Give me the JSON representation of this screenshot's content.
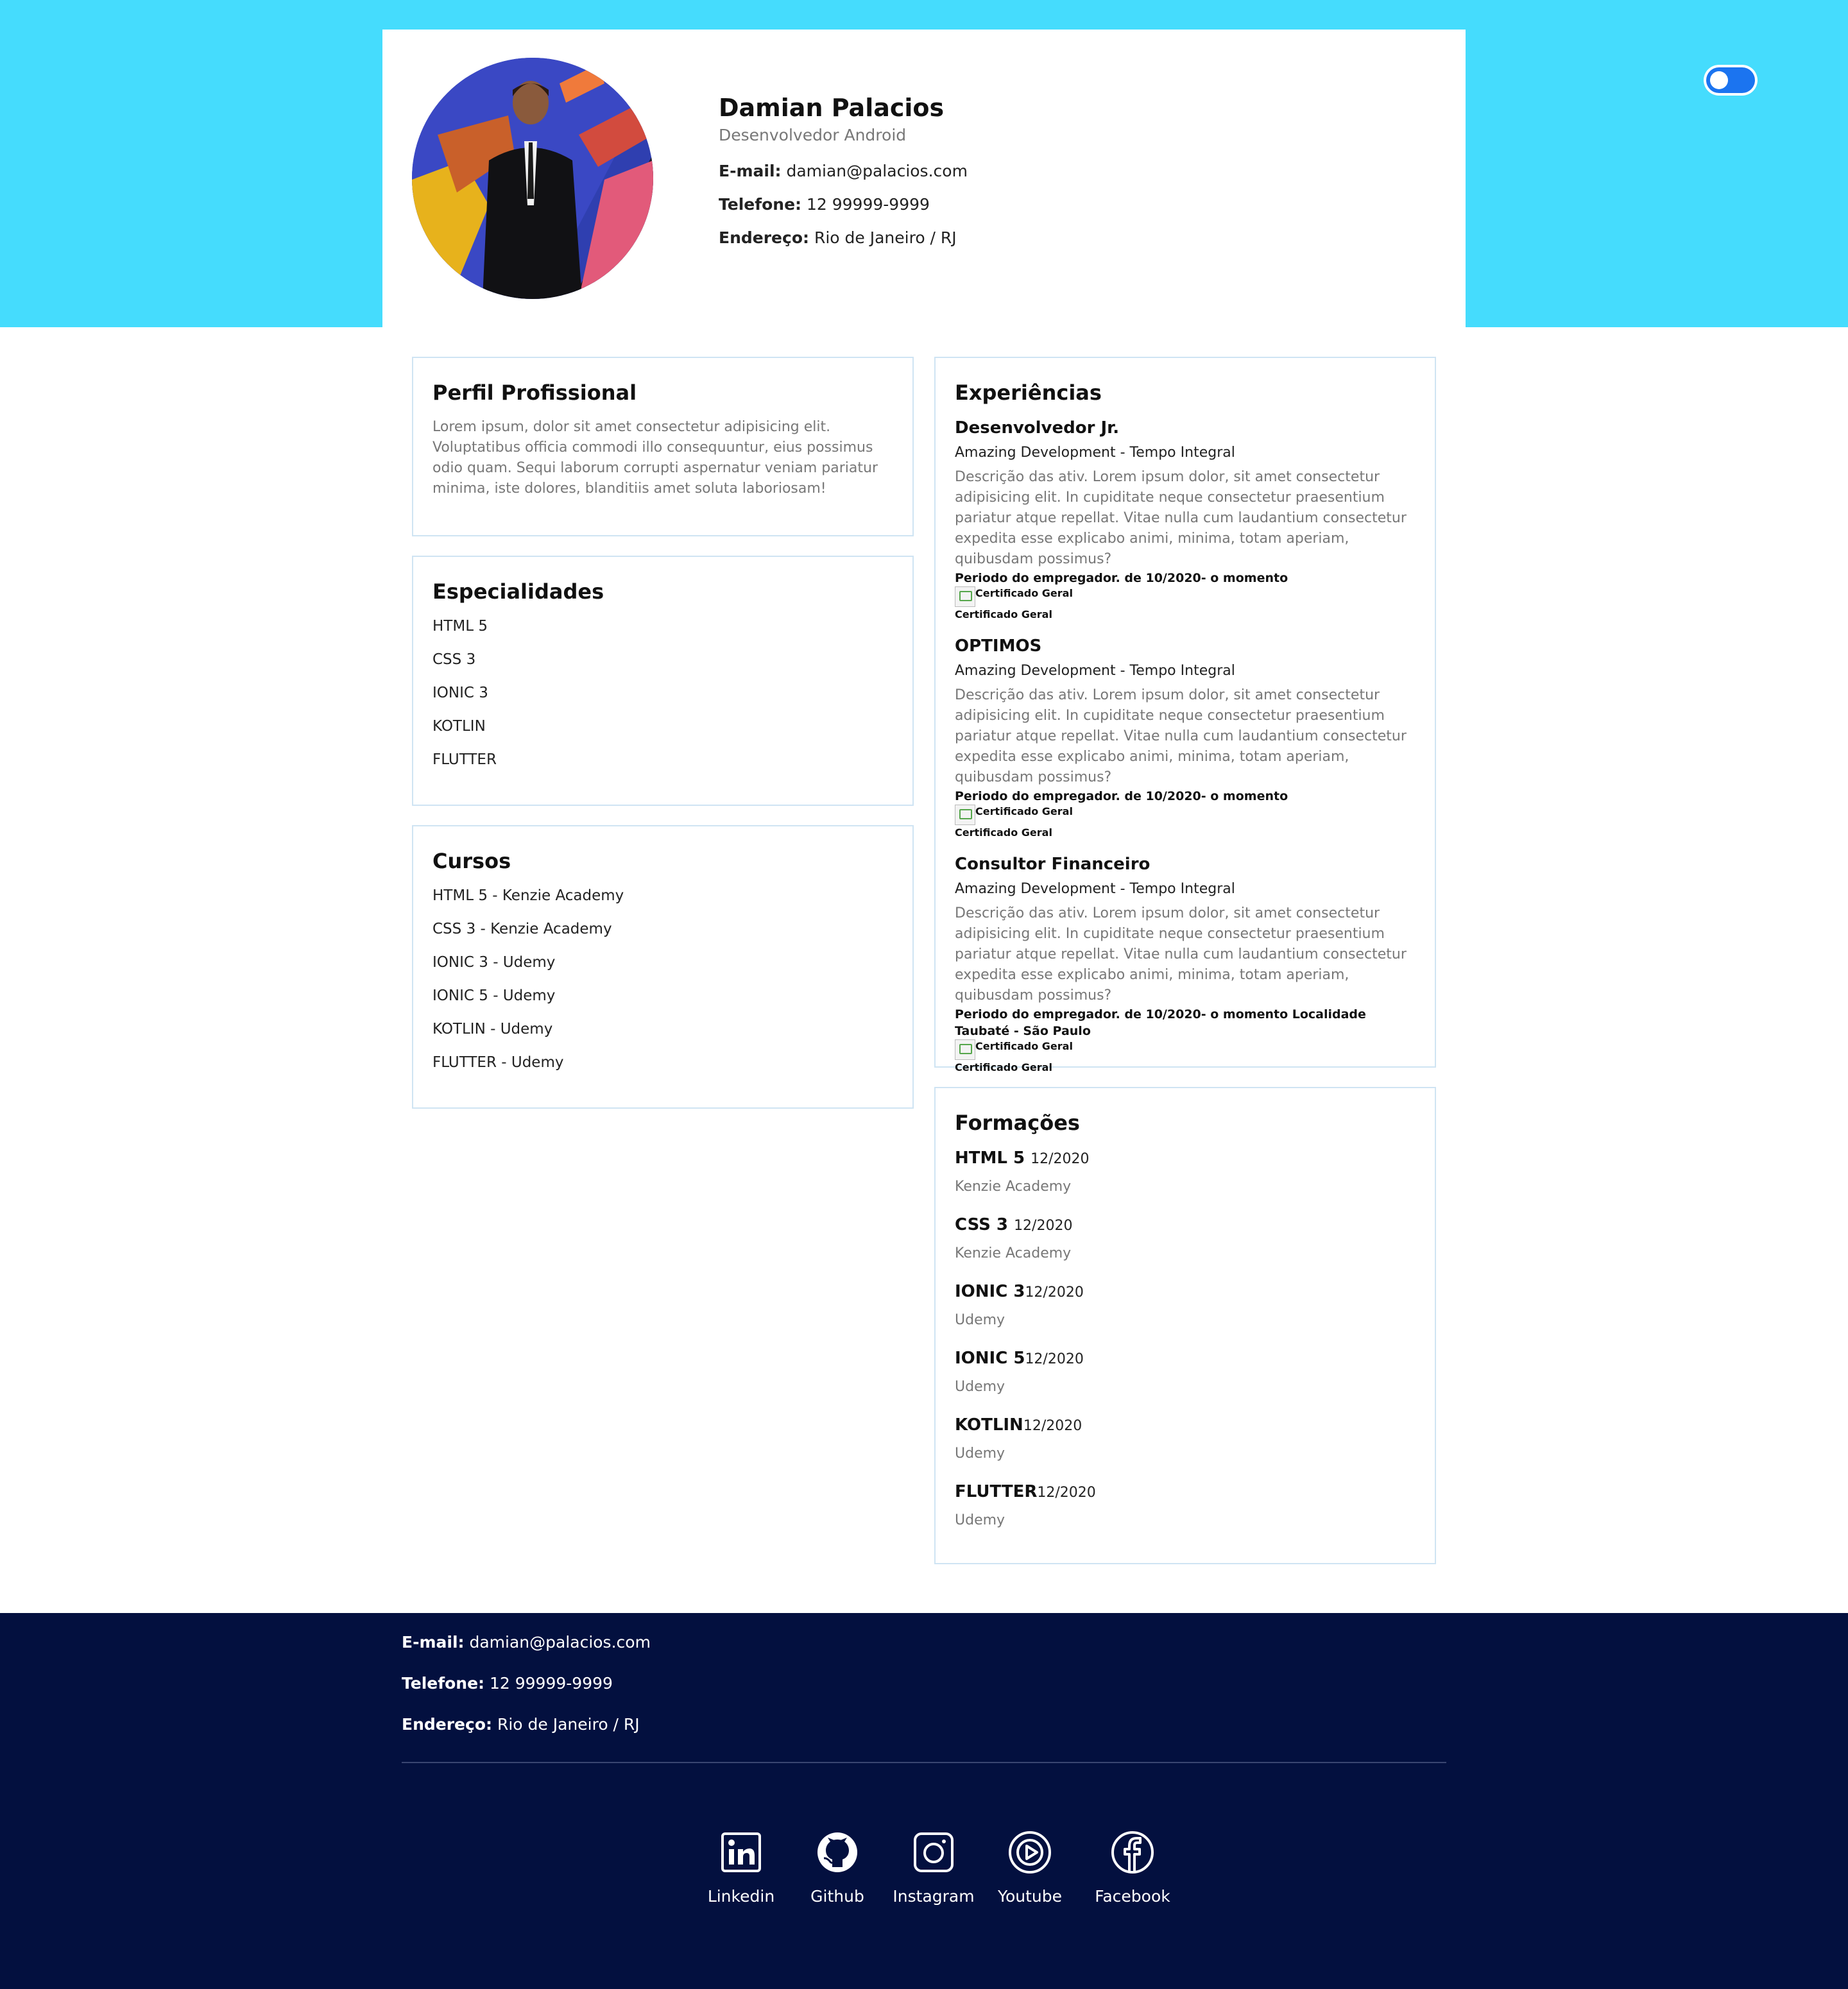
{
  "theme": {
    "header_bg": "#45dcfd",
    "footer_bg": "#03103f",
    "toggle_color": "#1b74f0",
    "card_border": "#cfe4f3"
  },
  "toggle": {
    "state": "on",
    "icon": "theme-toggle-switch"
  },
  "header": {
    "name": "Damian Palacios",
    "role": "Desenvolvedor Android",
    "email_label": "E-mail:",
    "email": "damian@palacios.com",
    "phone_label": "Telefone:",
    "phone": "12 99999-9999",
    "address_label": "Endereço:",
    "address": "Rio de Janeiro / RJ"
  },
  "perfil": {
    "title": "Perfil Profissional",
    "text": "Lorem ipsum, dolor sit amet consectetur adipisicing elit. Voluptatibus officia commodi illo consequuntur, eius possimus odio quam. Sequi laborum corrupti aspernatur veniam pariatur minima, iste dolores, blanditiis amet soluta laboriosam!"
  },
  "especialidades": {
    "title": "Especialidades",
    "items": [
      "HTML 5",
      "CSS 3",
      "IONIC 3",
      "KOTLIN",
      "FLUTTER"
    ]
  },
  "cursos": {
    "title": "Cursos",
    "items": [
      "HTML 5 - Kenzie Academy",
      "CSS 3 - Kenzie Academy",
      "IONIC 3 - Udemy",
      "IONIC 5 - Udemy",
      "KOTLIN - Udemy",
      "FLUTTER - Udemy"
    ]
  },
  "experiencias": {
    "title": "Experiências",
    "items": [
      {
        "title": "Desenvolvedor Jr.",
        "company": "Amazing Development - Tempo Integral",
        "description": "Descrição das ativ. Lorem ipsum dolor, sit amet consectetur adipisicing elit. In cupiditate neque consectetur praesentium pariatur atque repellat. Vitae nulla cum laudantium consectetur expedita esse explicabo animi, minima, totam aperiam, quibusdam possimus?",
        "period": "Periodo do empregador. de 10/2020- o momento",
        "cert_alt": "Certificado Geral",
        "cert_caption": "Certificado Geral"
      },
      {
        "title": "OPTIMOS",
        "company": "Amazing Development - Tempo Integral",
        "description": "Descrição das ativ. Lorem ipsum dolor, sit amet consectetur adipisicing elit. In cupiditate neque consectetur praesentium pariatur atque repellat. Vitae nulla cum laudantium consectetur expedita esse explicabo animi, minima, totam aperiam, quibusdam possimus?",
        "period": "Periodo do empregador. de 10/2020- o momento",
        "cert_alt": "Certificado Geral",
        "cert_caption": "Certificado Geral"
      },
      {
        "title": "Consultor Financeiro",
        "company": "Amazing Development - Tempo Integral",
        "description": "Descrição das ativ. Lorem ipsum dolor, sit amet consectetur adipisicing elit. In cupiditate neque consectetur praesentium pariatur atque repellat. Vitae nulla cum laudantium consectetur expedita esse explicabo animi, minima, totam aperiam, quibusdam possimus?",
        "period": "Periodo do empregador. de 10/2020- o momento Localidade Taubaté - São Paulo",
        "cert_alt": "Certificado Geral",
        "cert_caption": "Certificado Geral"
      }
    ]
  },
  "formacoes": {
    "title": "Formações",
    "items": [
      {
        "name": "HTML 5",
        "date": "12/2020",
        "school": "Kenzie Academy"
      },
      {
        "name": "CSS 3",
        "date": "12/2020",
        "school": "Kenzie Academy"
      },
      {
        "name": "IONIC 3",
        "date": "12/2020",
        "school": "Udemy"
      },
      {
        "name": "IONIC 5",
        "date": "12/2020",
        "school": "Udemy"
      },
      {
        "name": "KOTLIN",
        "date": "12/2020",
        "school": "Udemy"
      },
      {
        "name": "FLUTTER",
        "date": "12/2020",
        "school": "Udemy"
      }
    ]
  },
  "footer": {
    "email_label": "E-mail:",
    "email": "damian@palacios.com",
    "phone_label": "Telefone:",
    "phone": "12 99999-9999",
    "address_label": "Endereço:",
    "address": "Rio de Janeiro / RJ",
    "socials": [
      {
        "label": "Linkedin",
        "icon": "linkedin-icon"
      },
      {
        "label": "Github",
        "icon": "github-icon"
      },
      {
        "label": "Instagram",
        "icon": "instagram-icon"
      },
      {
        "label": "Youtube",
        "icon": "youtube-icon"
      },
      {
        "label": "Facebook",
        "icon": "facebook-icon"
      }
    ]
  }
}
